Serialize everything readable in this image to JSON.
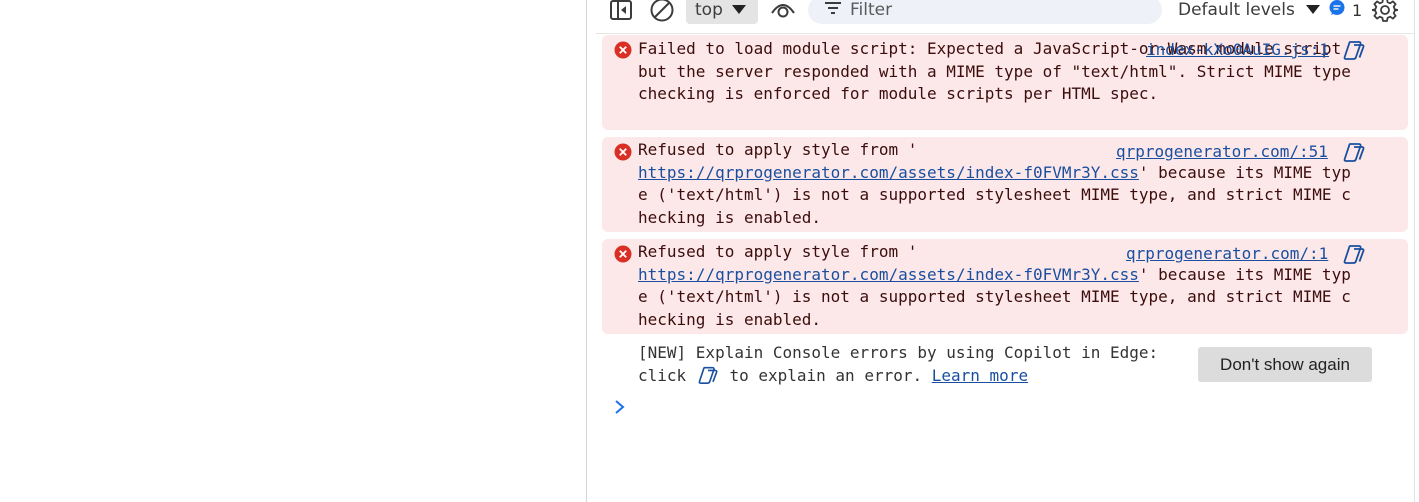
{
  "toolbar": {
    "context": "top",
    "filter_placeholder": "Filter",
    "levels_label": "Default levels",
    "issues_count": "1",
    "icons": [
      "sidebar-toggle-icon",
      "clear-console-icon",
      "live-expression-eye-icon",
      "filter-icon",
      "message-bubble-icon",
      "gear-icon"
    ]
  },
  "messages": [
    {
      "text_before": "Failed to load module script: Expected a JavaScript-or-Wasm module script but the server responded with a MIME type of \"text/html\". Strict MIME type checking is enforced for module scripts per HTML spec.",
      "source": "index-kXo0AuIG.js:1"
    },
    {
      "text_before": "Refused to apply style from '",
      "url": "https://qrprogenerator.com/assets/index-f0FVMr3Y.css",
      "text_after": "' because its MIME type ('text/html') is not a supported stylesheet MIME type, and strict MIME checking is enabled.",
      "source": "qrprogenerator.com/:51"
    },
    {
      "text_before": "Refused to apply style from '",
      "url": "https://qrprogenerator.com/assets/index-f0FVMr3Y.css",
      "text_after": "' because its MIME type ('text/html') is not a supported stylesheet MIME type, and strict MIME checking is enabled.",
      "source": "qrprogenerator.com/:1"
    }
  ],
  "info": {
    "line1": "[NEW] Explain Console errors by using Copilot in Edge:",
    "click": "click",
    "after_icon": "to explain an error.",
    "learn_more": "Learn more",
    "dont_show": "Don't show again"
  },
  "colors": {
    "error_bg": "#fce8e8",
    "error_icon": "#d93025",
    "link": "#1a4fa0",
    "prompt": "#1a73e8"
  }
}
